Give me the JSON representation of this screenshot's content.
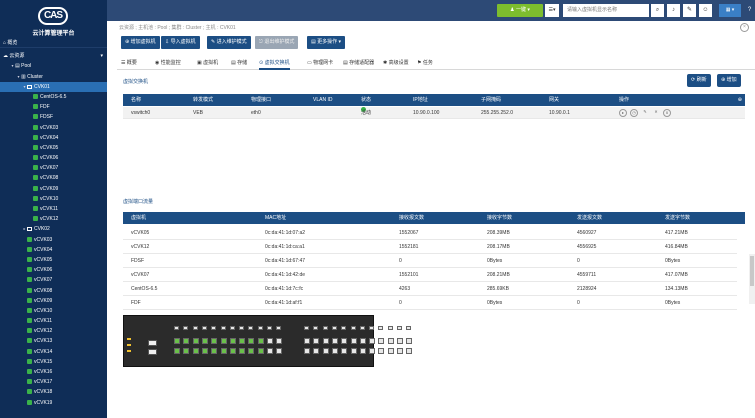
{
  "app": {
    "logo_text": "CAS",
    "name": "云计算管理平台"
  },
  "sidebar": {
    "top_items": [
      {
        "label": "概览",
        "icon": "home-icon",
        "level": 0,
        "toggle": ""
      },
      {
        "label": "云资源",
        "icon": "cloud-icon",
        "level": 0,
        "toggle": "▾"
      }
    ],
    "tree": [
      {
        "label": "Pool",
        "level": 1,
        "toggle": "▾",
        "kind": "pool"
      },
      {
        "label": "Cluster",
        "level": 2,
        "toggle": "▾",
        "kind": "cluster"
      },
      {
        "label": "CVK01",
        "level": 3,
        "toggle": "▾",
        "kind": "host",
        "selected": true
      },
      {
        "label": "CentOS-6.5",
        "level": 4,
        "toggle": "",
        "kind": "vm"
      },
      {
        "label": "FDF",
        "level": 4,
        "toggle": "",
        "kind": "vm"
      },
      {
        "label": "FDSF",
        "level": 4,
        "toggle": "",
        "kind": "vm"
      },
      {
        "label": "vCVK03",
        "level": 4,
        "toggle": "",
        "kind": "vm"
      },
      {
        "label": "vCVK04",
        "level": 4,
        "toggle": "",
        "kind": "vm"
      },
      {
        "label": "vCVK05",
        "level": 4,
        "toggle": "",
        "kind": "vm"
      },
      {
        "label": "vCVK06",
        "level": 4,
        "toggle": "",
        "kind": "vm"
      },
      {
        "label": "vCVK07",
        "level": 4,
        "toggle": "",
        "kind": "vm"
      },
      {
        "label": "vCVK08",
        "level": 4,
        "toggle": "",
        "kind": "vm"
      },
      {
        "label": "vCVK09",
        "level": 4,
        "toggle": "",
        "kind": "vm"
      },
      {
        "label": "vCVK10",
        "level": 4,
        "toggle": "",
        "kind": "vm"
      },
      {
        "label": "vCVK11",
        "level": 4,
        "toggle": "",
        "kind": "vm"
      },
      {
        "label": "vCVK12",
        "level": 4,
        "toggle": "",
        "kind": "vm"
      },
      {
        "label": "CVK02",
        "level": 3,
        "toggle": "▸",
        "kind": "host"
      },
      {
        "label": "vCVK03",
        "level": 3,
        "toggle": "",
        "kind": "vm"
      },
      {
        "label": "vCVK04",
        "level": 3,
        "toggle": "",
        "kind": "vm"
      },
      {
        "label": "vCVK05",
        "level": 3,
        "toggle": "",
        "kind": "vm"
      },
      {
        "label": "vCVK06",
        "level": 3,
        "toggle": "",
        "kind": "vm"
      },
      {
        "label": "vCVK07",
        "level": 3,
        "toggle": "",
        "kind": "vm"
      },
      {
        "label": "vCVK08",
        "level": 3,
        "toggle": "",
        "kind": "vm"
      },
      {
        "label": "vCVK09",
        "level": 3,
        "toggle": "",
        "kind": "vm"
      },
      {
        "label": "vCVK10",
        "level": 3,
        "toggle": "",
        "kind": "vm"
      },
      {
        "label": "vCVK11",
        "level": 3,
        "toggle": "",
        "kind": "vm"
      },
      {
        "label": "vCVK12",
        "level": 3,
        "toggle": "",
        "kind": "vm"
      },
      {
        "label": "vCVK13",
        "level": 3,
        "toggle": "",
        "kind": "vm"
      },
      {
        "label": "vCVK14",
        "level": 3,
        "toggle": "",
        "kind": "vm"
      },
      {
        "label": "vCVK15",
        "level": 3,
        "toggle": "",
        "kind": "vm"
      },
      {
        "label": "vCVK16",
        "level": 3,
        "toggle": "",
        "kind": "vm"
      },
      {
        "label": "vCVK17",
        "level": 3,
        "toggle": "",
        "kind": "vm"
      },
      {
        "label": "vCVK18",
        "level": 3,
        "toggle": "",
        "kind": "vm"
      },
      {
        "label": "vCVK19",
        "level": 3,
        "toggle": "",
        "kind": "vm"
      }
    ]
  },
  "topbar": {
    "quick_label": "一键",
    "menu_label": "▾",
    "search_placeholder": "请输入虚拟机显示名称",
    "icons": [
      "search-icon",
      "bell-icon",
      "wrench-icon",
      "user-icon",
      "help-icon"
    ]
  },
  "breadcrumb": "云资源 ; 主机池 : Pool ; 集群 : Cluster ; 主机 : CVK01",
  "actions": [
    {
      "label": "增加虚拟机",
      "icon": "plus-icon",
      "disabled": false
    },
    {
      "label": "导入虚拟机",
      "icon": "import-icon",
      "disabled": false
    },
    {
      "label": "进入维护模式",
      "icon": "wrench-icon",
      "disabled": false
    },
    {
      "label": "退出维护模式",
      "icon": "exit-icon",
      "disabled": true
    },
    {
      "label": "更多操作",
      "icon": "more-icon",
      "disabled": false,
      "suffix": "▾"
    }
  ],
  "tabs": [
    {
      "label": "概要",
      "icon": "list-icon"
    },
    {
      "label": "性能监控",
      "icon": "chart-icon"
    },
    {
      "label": "虚拟机",
      "icon": "vm-icon"
    },
    {
      "label": "存储",
      "icon": "storage-icon"
    },
    {
      "label": "虚拟交换机",
      "icon": "switch-icon",
      "active": true
    },
    {
      "label": "物理网卡",
      "icon": "nic-icon"
    },
    {
      "label": "存储适配器",
      "icon": "adapter-icon"
    },
    {
      "label": "高级设置",
      "icon": "gear-icon"
    },
    {
      "label": "任务",
      "icon": "task-icon"
    }
  ],
  "vswitch_section": {
    "title": "虚拟交换机",
    "refresh_label": "刷新",
    "add_label": "增加",
    "columns": [
      "名称",
      "转发模式",
      "物理接口",
      "VLAN ID",
      "状态",
      "IP地址",
      "子网掩码",
      "网关",
      "操作"
    ],
    "rows": [
      {
        "name": "vswitch0",
        "mode": "VEB",
        "iface": "eth0",
        "vlan": "",
        "status": "活动",
        "ip": "10.90.0.100",
        "mask": "255.255.252.0",
        "gw": "10.90.0.1"
      }
    ]
  },
  "traffic_section": {
    "title": "虚拟端口流量",
    "columns": [
      "虚拟机",
      "MAC地址",
      "接收报文数",
      "接收字节数",
      "发送报文数",
      "发送字节数"
    ],
    "rows": [
      {
        "vm": "vCVK05",
        "mac": "0c:da:41:1d:07:a2",
        "rx_pkts": "1552067",
        "rx_bytes": "208.39MB",
        "tx_pkts": "4560927",
        "tx_bytes": "417.21MB"
      },
      {
        "vm": "vCVK12",
        "mac": "0c:da:41:1d:ca:a1",
        "rx_pkts": "1552181",
        "rx_bytes": "208.17MB",
        "tx_pkts": "4556925",
        "tx_bytes": "416.84MB"
      },
      {
        "vm": "FDSF",
        "mac": "0c:da:41:1d:67:47",
        "rx_pkts": "0",
        "rx_bytes": "0Bytes",
        "tx_pkts": "0",
        "tx_bytes": "0Bytes"
      },
      {
        "vm": "vCVK07",
        "mac": "0c:da:41:1d:42:de",
        "rx_pkts": "1552101",
        "rx_bytes": "208.21MB",
        "tx_pkts": "4559711",
        "tx_bytes": "417.07MB"
      },
      {
        "vm": "CentOS-6.5",
        "mac": "0c:da:41:1d:7c:fc",
        "rx_pkts": "4263",
        "rx_bytes": "285.69KB",
        "tx_pkts": "2128924",
        "tx_bytes": "134.13MB"
      },
      {
        "vm": "FDF",
        "mac": "0c:da:41:1d:af:f1",
        "rx_pkts": "0",
        "rx_bytes": "0Bytes",
        "tx_pkts": "0",
        "tx_bytes": "0Bytes"
      }
    ]
  },
  "colors": {
    "sidebar_bg": "#0f2d57",
    "primary": "#1c4e84",
    "selected_row": "#2a6fb4",
    "green": "#3ab24a",
    "topbar_green": "#7dbd2e"
  }
}
